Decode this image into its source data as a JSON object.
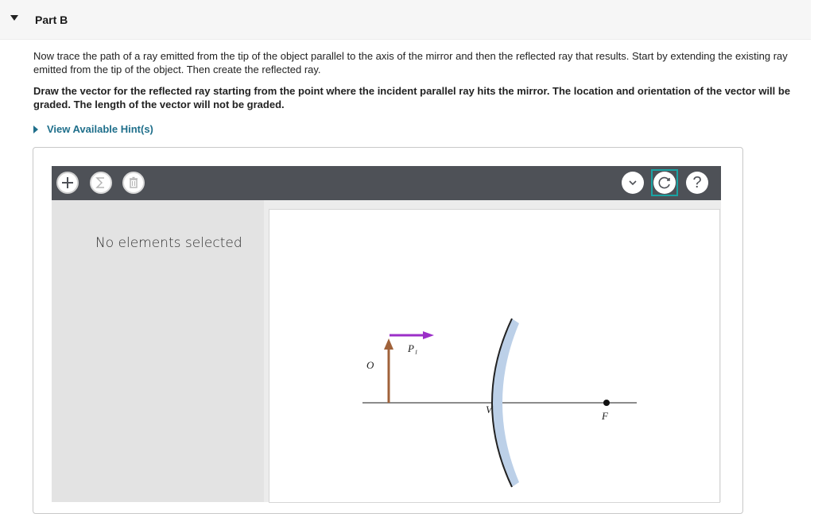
{
  "part": {
    "title": "Part B"
  },
  "instructions": {
    "paragraph1": "Now trace the path of a ray emitted from the tip of the object parallel to the axis of the mirror and then the reflected ray that results. Start by extending the existing ray emitted from the tip of the object. Then create the reflected ray.",
    "paragraph2": "Draw the vector for the reflected ray starting from the point where the incident parallel ray hits the mirror. The location and orientation of the vector will be graded. The length of the vector will not be graded."
  },
  "hint": {
    "label": "View Available Hint(s)"
  },
  "toolbar": {
    "add_icon": "plus-icon",
    "sum_icon": "sigma-icon",
    "delete_icon": "trash-icon",
    "dropdown_icon": "chevron-down-icon",
    "reset_icon": "reset-icon",
    "help_label": "?"
  },
  "sidebar": {
    "status": "No elements selected"
  },
  "diagram": {
    "labels": {
      "object": "O",
      "ray": "P₁",
      "vertex": "V",
      "focus": "F"
    },
    "colors": {
      "object_arrow": "#a0623a",
      "ray_vector": "#9b2fc8",
      "mirror_fill": "#bcd0e8",
      "mirror_edge": "#222222",
      "axis": "#666666"
    }
  }
}
